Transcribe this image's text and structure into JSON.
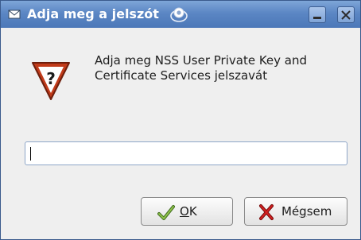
{
  "window": {
    "title": "Adja meg a jelszót",
    "title_icon": "envelope-icon",
    "logo": "opensuse-logo",
    "controls": {
      "minimize": "minimize-icon",
      "close": "close-icon"
    }
  },
  "dialog": {
    "icon": "question-icon",
    "prompt": "Adja meg NSS User Private Key and Certificate Services jelszavát",
    "password_value": ""
  },
  "buttons": {
    "ok_mnemonic": "O",
    "ok_rest": "K",
    "ok_icon": "checkmark-icon",
    "cancel_pre": "Mé",
    "cancel_mnemonic": "g",
    "cancel_post": "sem",
    "cancel_icon": "cross-icon"
  },
  "colors": {
    "titlebar": "#5b86c4",
    "background": "#efefef",
    "question_icon": "#c13b1a"
  }
}
